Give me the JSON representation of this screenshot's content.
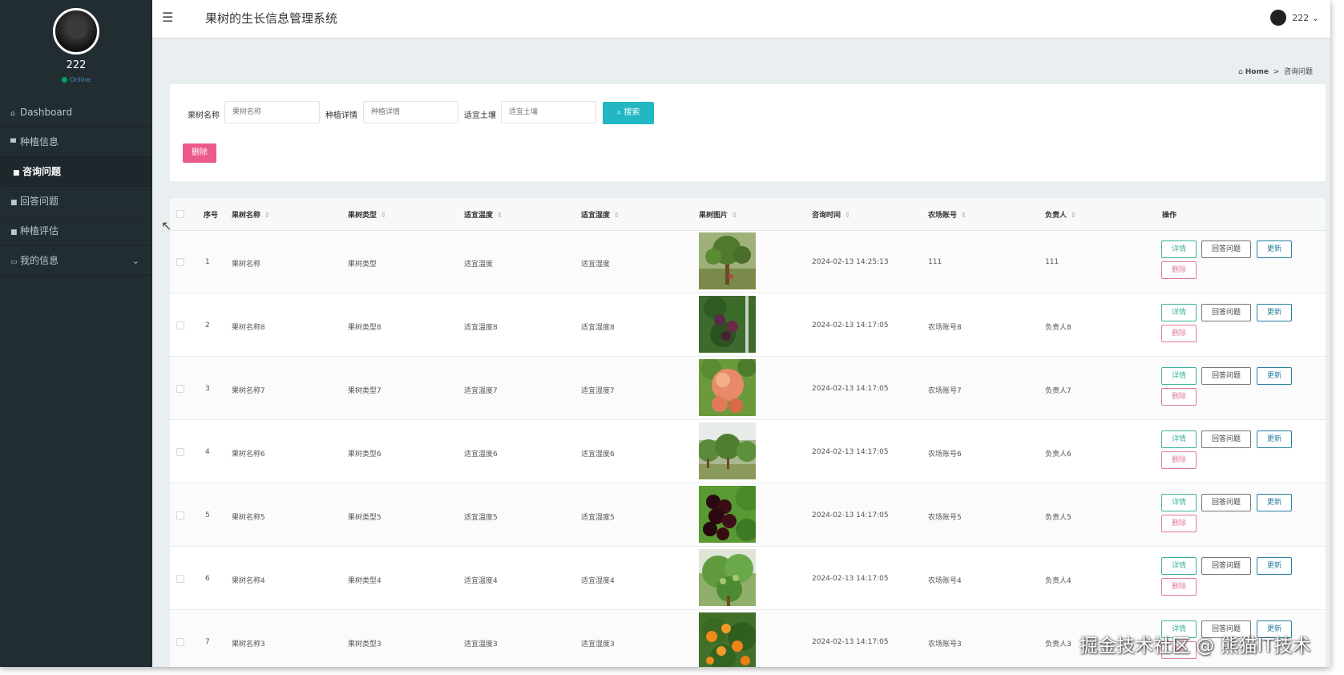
{
  "app": {
    "title": "果树的生长信息管理系统"
  },
  "user": {
    "name": "222",
    "status": "Online"
  },
  "header": {
    "user_label": "222 ⌄"
  },
  "sidebar": {
    "items": [
      {
        "icon": "⌂",
        "label": "Dashboard"
      },
      {
        "icon": "▀",
        "label": "种植信息"
      },
      {
        "icon": "■",
        "label": "咨询问题"
      },
      {
        "icon": "■",
        "label": "回答问题"
      },
      {
        "icon": "■",
        "label": "种植评估"
      },
      {
        "icon": "▭",
        "label": "我的信息"
      }
    ],
    "active_index": 2
  },
  "breadcrumb": {
    "home": "Home",
    "separator": ">",
    "current": "咨询问题"
  },
  "search": {
    "fields": [
      {
        "label": "果树名称",
        "placeholder": "果树名称"
      },
      {
        "label": "种植详情",
        "placeholder": "种植详情"
      },
      {
        "label": "适宜土壤",
        "placeholder": "适宜土壤"
      }
    ],
    "search_button": "搜索",
    "delete_button": "删除"
  },
  "table": {
    "columns": [
      "序号",
      "果树名称",
      "果树类型",
      "适宜温度",
      "适宜湿度",
      "果树图片",
      "咨询时间",
      "农场账号",
      "负责人",
      "操作"
    ],
    "actions": {
      "detail": "详情",
      "answer": "回答问题",
      "update": "更新",
      "delete": "删除"
    },
    "rows": [
      {
        "index": "1",
        "name": "果树名称",
        "type": "果树类型",
        "temp": "适宜温度",
        "humidity": "适宜湿度",
        "image": "orchard-tree",
        "time": "2024-02-13 14:25:13",
        "farm": "111",
        "owner": "111"
      },
      {
        "index": "2",
        "name": "果树名称8",
        "type": "果树类型8",
        "temp": "适宜温度8",
        "humidity": "适宜湿度8",
        "image": "plums-on-branch",
        "time": "2024-02-13 14:17:05",
        "farm": "农场账号8",
        "owner": "负责人8"
      },
      {
        "index": "3",
        "name": "果树名称7",
        "type": "果树类型7",
        "temp": "适宜温度7",
        "humidity": "适宜湿度7",
        "image": "peaches",
        "time": "2024-02-13 14:17:05",
        "farm": "农场账号7",
        "owner": "负责人7"
      },
      {
        "index": "4",
        "name": "果树名称6",
        "type": "果树类型6",
        "temp": "适宜温度6",
        "humidity": "适宜湿度6",
        "image": "orchard-rows",
        "time": "2024-02-13 14:17:05",
        "farm": "农场账号6",
        "owner": "负责人6"
      },
      {
        "index": "5",
        "name": "果树名称5",
        "type": "果树类型5",
        "temp": "适宜温度5",
        "humidity": "适宜湿度5",
        "image": "cherries",
        "time": "2024-02-13 14:17:05",
        "farm": "农场账号5",
        "owner": "负责人5"
      },
      {
        "index": "6",
        "name": "果树名称4",
        "type": "果树类型4",
        "temp": "适宜温度4",
        "humidity": "适宜湿度4",
        "image": "green-fruit-tree",
        "time": "2024-02-13 14:17:05",
        "farm": "农场账号4",
        "owner": "负责人4"
      },
      {
        "index": "7",
        "name": "果树名称3",
        "type": "果树类型3",
        "temp": "适宜温度3",
        "humidity": "适宜湿度3",
        "image": "oranges",
        "time": "2024-02-13 14:17:05",
        "farm": "农场账号3",
        "owner": "负责人3"
      }
    ]
  },
  "watermark": "掘金技术社区 @ 熊猫IT技术"
}
